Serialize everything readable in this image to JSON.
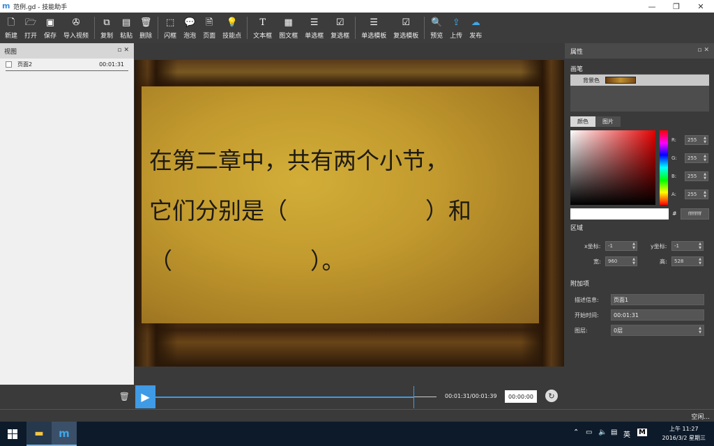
{
  "window": {
    "title": "范例.gd - 技能助手",
    "minimize_icon": "—",
    "restore_icon": "❐",
    "close_icon": "✕"
  },
  "toolbar": {
    "new": "新建",
    "open": "打开",
    "save": "保存",
    "import_video": "导入视频",
    "copy": "复制",
    "paste": "粘贴",
    "delete": "删除",
    "flash_box": "闪框",
    "bubble": "泡泡",
    "page": "页面",
    "skill_point": "技能点",
    "text_box": "文本框",
    "image_text_box": "图文框",
    "single_choice": "单选框",
    "multi_choice": "复选框",
    "single_template": "单选模板",
    "multi_template": "复选模板",
    "preview": "预览",
    "upload": "上传",
    "publish": "发布"
  },
  "left_panel": {
    "title": "视图",
    "pages": [
      {
        "name": "页面2",
        "time": "00:01:31"
      }
    ]
  },
  "slide": {
    "lines": [
      "在第二章中，共有两个小节，",
      "它们分别是（　　　　　　）和",
      "（　　　　　　）。"
    ]
  },
  "player": {
    "time_text": "00:01:31/00:01:39",
    "current_time": "00:00:00",
    "progress": 0.92
  },
  "properties": {
    "title": "属性",
    "brush_section": "画笔",
    "background_label": "背景色",
    "tab_color": "颜色",
    "tab_image": "图片",
    "r_label": "R:",
    "r": "255",
    "g_label": "G:",
    "g": "255",
    "b_label": "B:",
    "b": "255",
    "a_label": "A:",
    "a": "255",
    "hex_label": "#",
    "hex": "ffffffff",
    "region_section": "区域",
    "x_label": "x坐标:",
    "x": "-1",
    "y_label": "y坐标:",
    "y": "-1",
    "w_label": "宽:",
    "w": "960",
    "h_label": "高:",
    "h": "528",
    "extra_section": "附加项",
    "desc_label": "描述信息:",
    "desc": "页面1",
    "start_label": "开始时间:",
    "start": "00:01:31",
    "layer_label": "图层:",
    "layer": "0层"
  },
  "status": {
    "text": "空闲..."
  },
  "taskbar": {
    "ime": "英",
    "ime_mode": "M",
    "time": "上午 11:27",
    "date": "2016/3/2 星期三"
  },
  "colors": {
    "accent": "#3f9be6",
    "panel": "#3a3a3a",
    "taskbar": "#0d1a2a"
  }
}
